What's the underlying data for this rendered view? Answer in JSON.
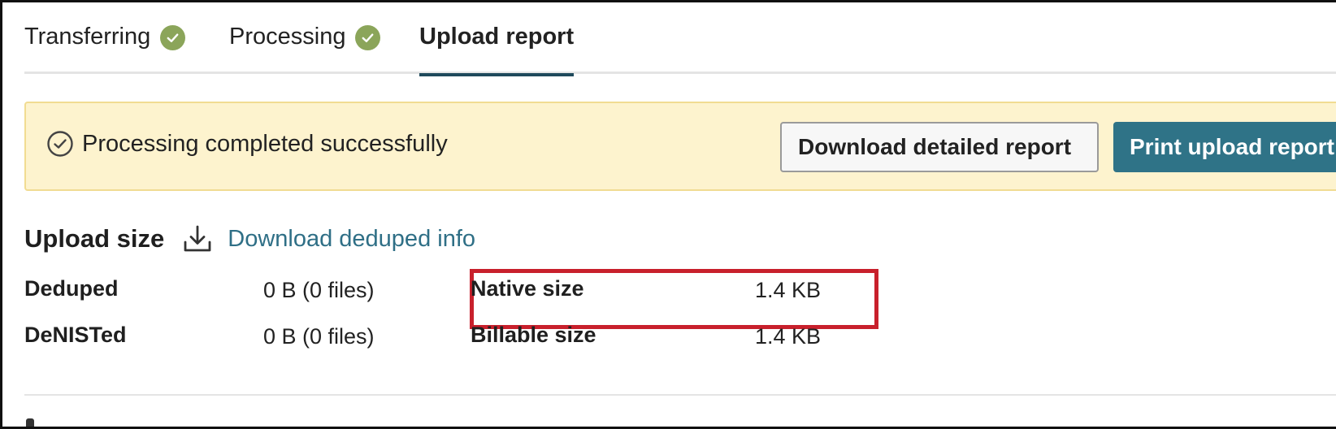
{
  "tabs": [
    {
      "label": "Transferring",
      "status": "complete"
    },
    {
      "label": "Processing",
      "status": "complete"
    },
    {
      "label": "Upload report",
      "status": "active"
    }
  ],
  "banner": {
    "message": "Processing completed successfully",
    "download_button_label": "Download detailed report",
    "print_button_label": "Print upload report",
    "icon": "check-circle-icon"
  },
  "upload_size": {
    "title": "Upload size",
    "download_link_label": "Download deduped info",
    "icon": "download-icon",
    "stats_left": [
      {
        "label": "Deduped",
        "value": "0 B (0 files)"
      },
      {
        "label": "DeNISTed",
        "value": "0 B (0 files)"
      }
    ],
    "stats_right": [
      {
        "label": "Native size",
        "value": "1.4 KB"
      },
      {
        "label": "Billable size",
        "value": "1.4 KB"
      }
    ]
  },
  "colors": {
    "accent": "#2f7387",
    "success": "#8ba55a",
    "banner_bg": "#fdf3ce",
    "highlight": "#c8202c",
    "link": "#2f6f86"
  }
}
